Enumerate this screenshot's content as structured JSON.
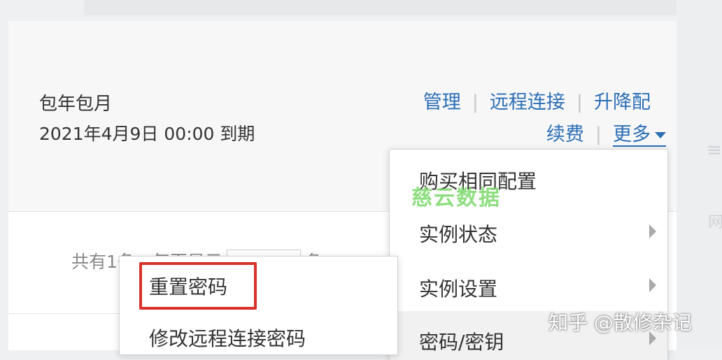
{
  "billing": {
    "type": "包年包月",
    "expire": "2021年4月9日 00:00 到期"
  },
  "actions": {
    "manage": "管理",
    "remote_connect": "远程连接",
    "upgrade": "升降配",
    "renew": "续费",
    "more": "更多",
    "separator": "|"
  },
  "paging": {
    "prefix": "共有1条，每页显示",
    "suffix": "条"
  },
  "more_menu": {
    "items": [
      {
        "label": "购买相同配置"
      },
      {
        "label": "实例状态"
      },
      {
        "label": "实例设置"
      },
      {
        "label": "密码/密钥"
      }
    ]
  },
  "password_menu": {
    "items": [
      {
        "label": "重置密码"
      },
      {
        "label": "修改远程连接密码"
      }
    ]
  },
  "watermark": "慈云数据",
  "credit": "知乎 @散修杂记"
}
